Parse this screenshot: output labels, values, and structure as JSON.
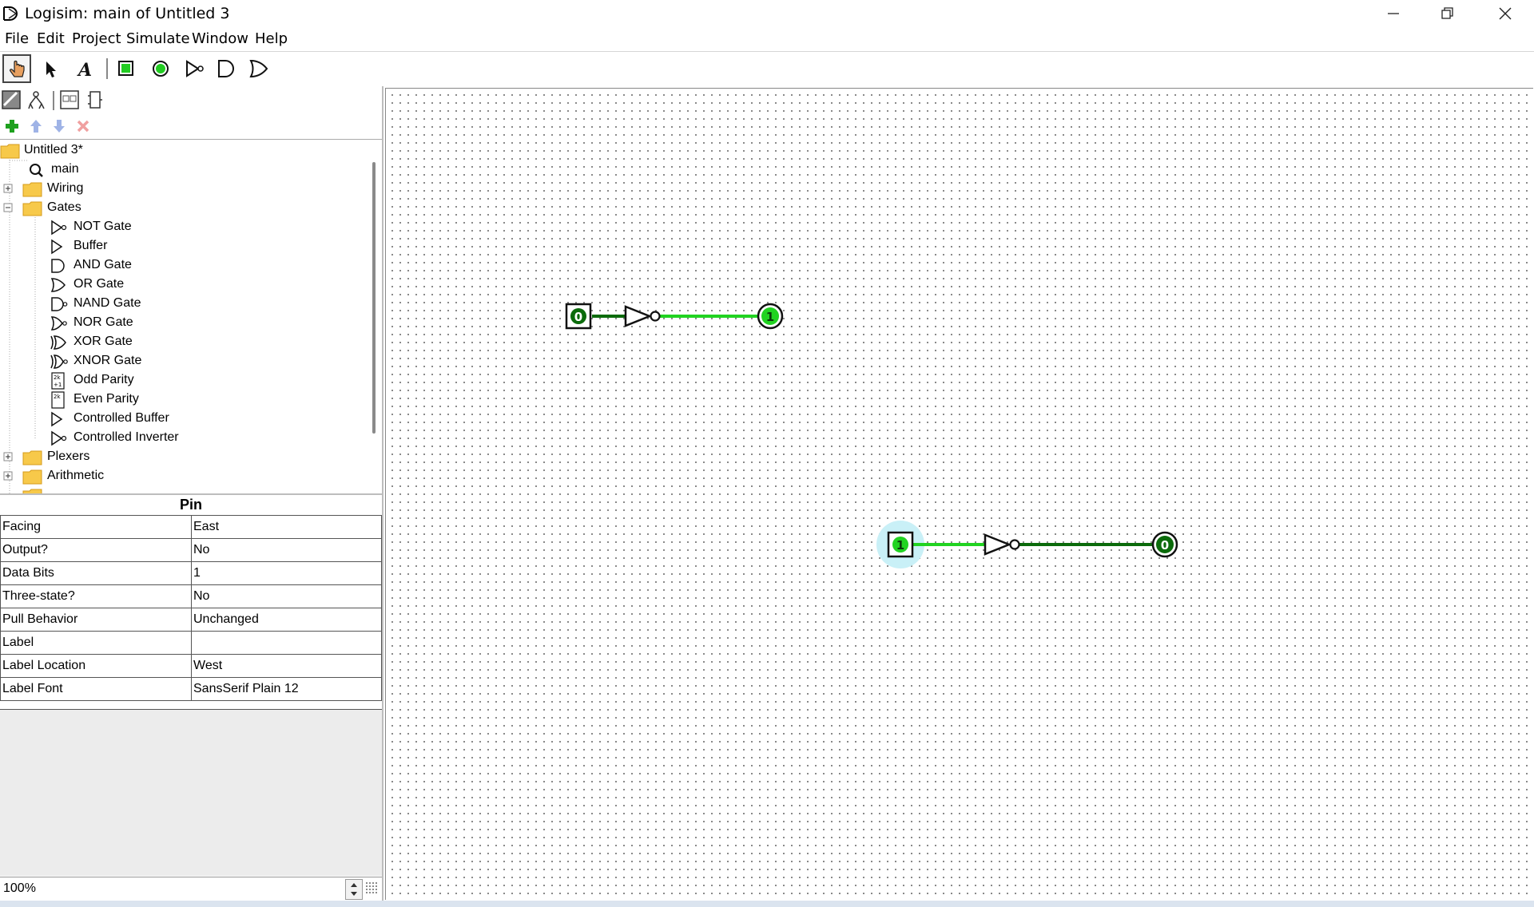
{
  "window": {
    "title": "Logisim: main of Untitled 3",
    "minimize_icon": "minimize-icon",
    "maximize_icon": "restore-icon",
    "close_icon": "close-icon"
  },
  "menu": [
    "File",
    "Edit",
    "Project",
    "Simulate",
    "Window",
    "Help"
  ],
  "toolbar": {
    "tools": [
      "poke-tool-icon",
      "select-tool-icon",
      "text-tool-icon",
      "input-pin-icon",
      "output-pin-icon",
      "not-gate-icon",
      "and-gate-icon",
      "or-gate-icon"
    ],
    "text_tool_label": "A",
    "project_tools": [
      "show-toolbox-icon",
      "show-simulation-icon",
      "edit-layout-icon",
      "edit-appearance-icon"
    ],
    "circuit_tools": [
      "add-circuit-icon",
      "move-up-icon",
      "move-down-icon",
      "delete-circuit-icon"
    ]
  },
  "explorer": {
    "items": [
      {
        "label": "Untitled 3*",
        "icon": "folder-icon"
      },
      {
        "label": "main",
        "icon": "circuit-icon"
      },
      {
        "label": "Wiring",
        "icon": "folder-icon"
      },
      {
        "label": "Gates",
        "icon": "folder-icon"
      },
      {
        "label": "NOT Gate",
        "icon": "not-gate-icon"
      },
      {
        "label": "Buffer",
        "icon": "buffer-icon"
      },
      {
        "label": "AND Gate",
        "icon": "and-gate-icon"
      },
      {
        "label": "OR Gate",
        "icon": "or-gate-icon"
      },
      {
        "label": "NAND Gate",
        "icon": "nand-gate-icon"
      },
      {
        "label": "NOR Gate",
        "icon": "nor-gate-icon"
      },
      {
        "label": "XOR Gate",
        "icon": "xor-gate-icon"
      },
      {
        "label": "XNOR Gate",
        "icon": "xnor-gate-icon"
      },
      {
        "label": "Odd Parity",
        "icon": "odd-parity-icon"
      },
      {
        "label": "Even Parity",
        "icon": "even-parity-icon"
      },
      {
        "label": "Controlled Buffer",
        "icon": "controlled-buffer-icon"
      },
      {
        "label": "Controlled Inverter",
        "icon": "controlled-inverter-icon"
      },
      {
        "label": "Plexers",
        "icon": "folder-icon"
      },
      {
        "label": "Arithmetic",
        "icon": "folder-icon"
      }
    ],
    "parity_odd_glyph": "2k\n+1",
    "parity_even_glyph": "2k"
  },
  "attributes": {
    "title": "Pin",
    "rows": [
      {
        "key": "Facing",
        "value": "East"
      },
      {
        "key": "Output?",
        "value": "No"
      },
      {
        "key": "Data Bits",
        "value": "1"
      },
      {
        "key": "Three-state?",
        "value": "No"
      },
      {
        "key": "Pull Behavior",
        "value": "Unchanged"
      },
      {
        "key": "Label",
        "value": ""
      },
      {
        "key": "Label Location",
        "value": "West"
      },
      {
        "key": "Label Font",
        "value": "SansSerif Plain 12"
      }
    ]
  },
  "zoom": "100%",
  "circuit": {
    "circuit1": {
      "input_value": "0",
      "output_value": "1"
    },
    "circuit2": {
      "input_value": "1",
      "output_value": "0"
    }
  },
  "colors": {
    "wire_true": "#21d321",
    "wire_false": "#0b6b0b",
    "pin_fill": "#22cc22",
    "selection_halo": "#c9f0f7",
    "folder": "#f7c94a"
  }
}
